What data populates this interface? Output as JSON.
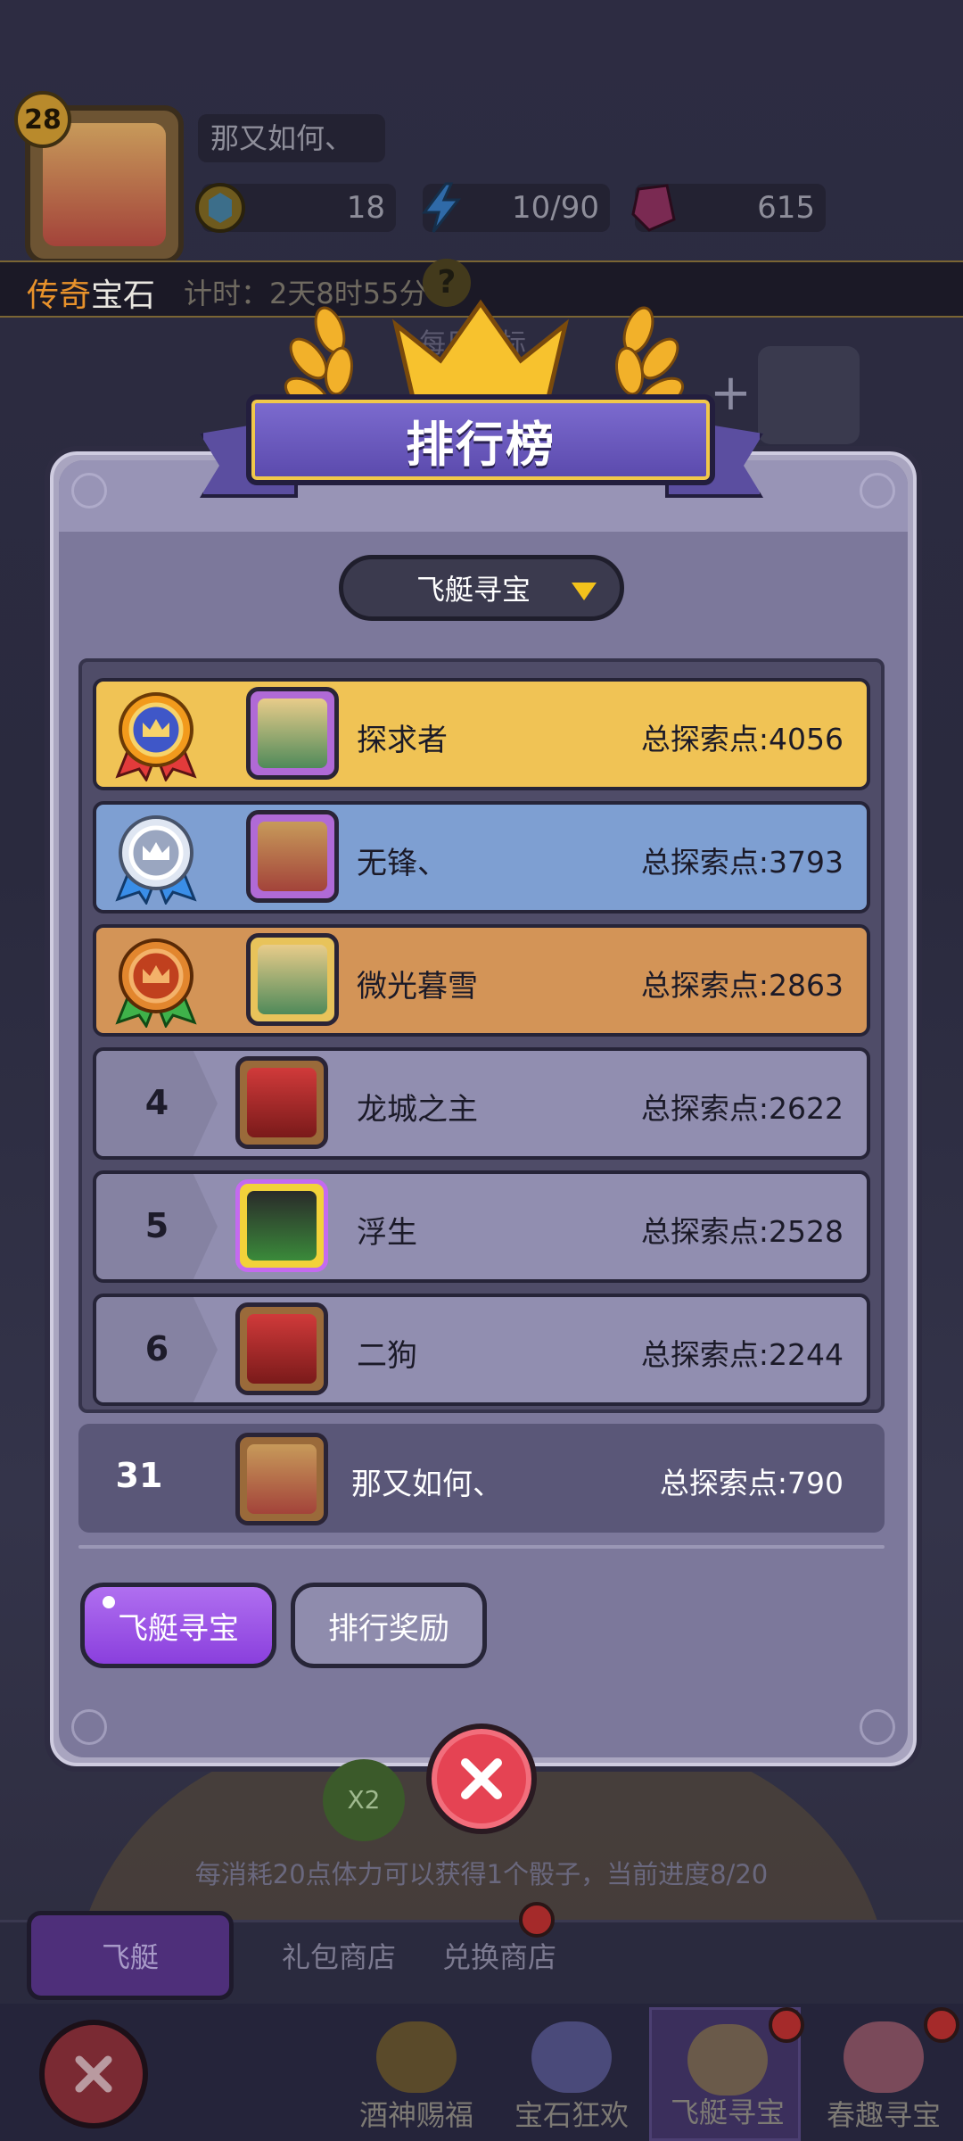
{
  "header": {
    "level": "28",
    "player_name": "那又如何、",
    "resources": {
      "coins": "18",
      "energy": "10/90",
      "gems": "615"
    }
  },
  "event_bar": {
    "title_part1": "传奇",
    "title_part2": "宝石",
    "countdown": "计时：2天8时55分",
    "help_symbol": "?"
  },
  "background": {
    "daily_target": "每日目标",
    "x2": "X2",
    "progress_hint": "每消耗20点体力可以获得1个骰子，当前进度8/20"
  },
  "modal": {
    "title": "排行榜",
    "dropdown_value": "飞艇寻宝",
    "score_label": "总探索点",
    "rows": [
      {
        "rank": "1",
        "name": "探求者",
        "score": "总探索点:4056"
      },
      {
        "rank": "2",
        "name": "无锋、",
        "score": "总探索点:3793"
      },
      {
        "rank": "3",
        "name": "微光暮雪",
        "score": "总探索点:2863"
      },
      {
        "rank": "4",
        "name": "龙城之主",
        "score": "总探索点:2622"
      },
      {
        "rank": "5",
        "name": "浮生",
        "score": "总探索点:2528"
      },
      {
        "rank": "6",
        "name": "二狗",
        "score": "总探索点:2244"
      }
    ],
    "my_row": {
      "rank": "31",
      "name": "那又如何、",
      "score": "总探索点:790"
    },
    "tabs": [
      "飞艇寻宝",
      "排行奖励"
    ]
  },
  "subtabs": [
    "飞艇",
    "礼包商店",
    "兑换商店"
  ],
  "bottom_nav": [
    "酒神赐福",
    "宝石狂欢",
    "飞艇寻宝",
    "春趣寻宝"
  ],
  "colors": {
    "gold_row": "#f0c355",
    "silver_row": "#7e9fd2",
    "bronze_row": "#d39457",
    "normal_row": "#918eb0",
    "active_tab": "#9a52e8",
    "close_button": "#e54353"
  }
}
